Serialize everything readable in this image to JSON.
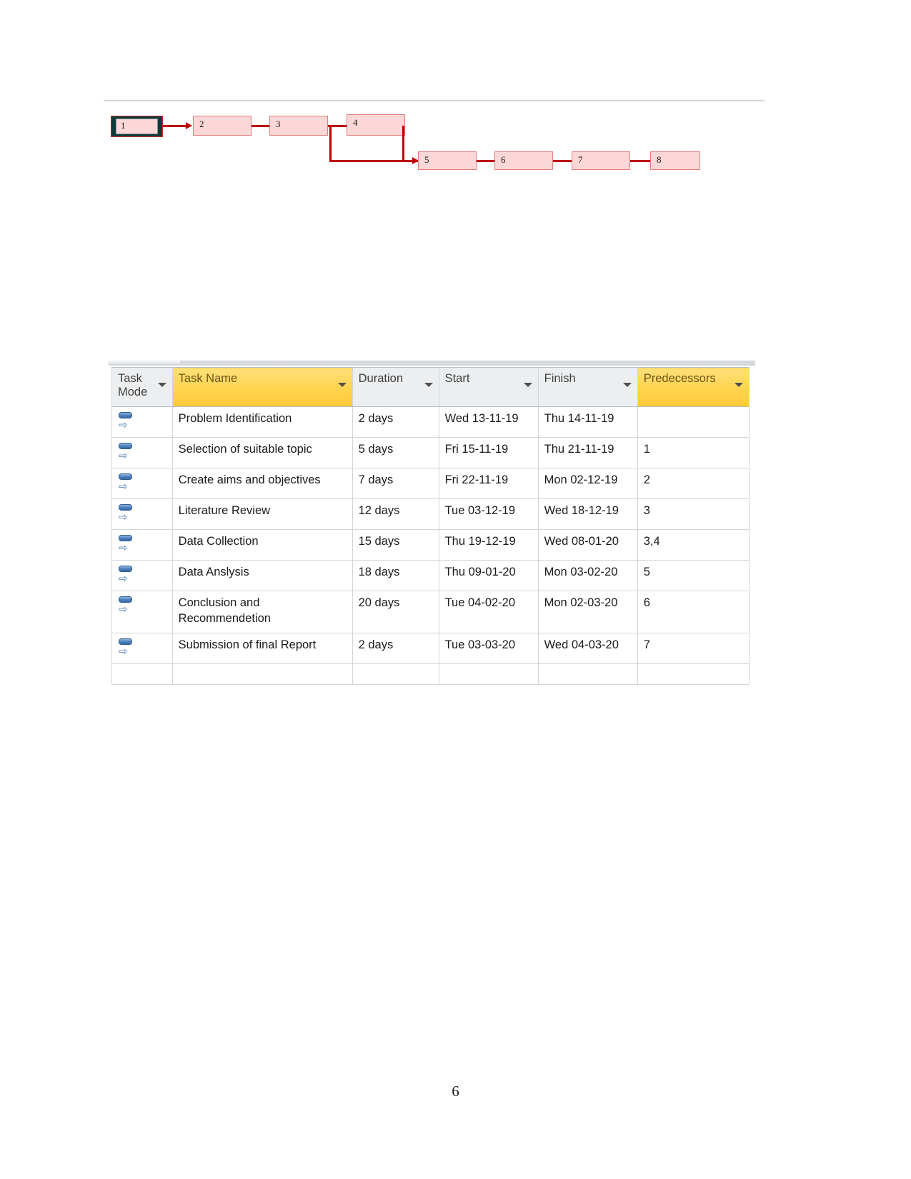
{
  "page": {
    "number": "6"
  },
  "network_diagram": {
    "name": "project-network-diagram",
    "node_fill_color": "#fbd7d7",
    "node_border_color": "#e87c7c",
    "connector_color": "#c00000",
    "selection_color": "#0d3b3b",
    "nodes": [
      {
        "id": "1",
        "label": "1",
        "selected": true
      },
      {
        "id": "2",
        "label": "2",
        "selected": false
      },
      {
        "id": "3",
        "label": "3",
        "selected": false
      },
      {
        "id": "4",
        "label": "4",
        "selected": false
      },
      {
        "id": "5",
        "label": "5",
        "selected": false
      },
      {
        "id": "6",
        "label": "6",
        "selected": false
      },
      {
        "id": "7",
        "label": "7",
        "selected": false
      },
      {
        "id": "8",
        "label": "8",
        "selected": false
      }
    ],
    "links": [
      {
        "from": "1",
        "to": "2"
      },
      {
        "from": "2",
        "to": "3"
      },
      {
        "from": "3",
        "to": "4"
      },
      {
        "from": "3",
        "to": "5"
      },
      {
        "from": "4",
        "to": "5"
      },
      {
        "from": "5",
        "to": "6"
      },
      {
        "from": "6",
        "to": "7"
      },
      {
        "from": "7",
        "to": "8"
      }
    ]
  },
  "gantt": {
    "name": "project-schedule-table",
    "header_highlight_color": "#ffd34d",
    "selected_cell_color": "#dce6f4",
    "columns": [
      {
        "key": "mode",
        "label": "Task Mode",
        "highlighted": false,
        "has_filter": true
      },
      {
        "key": "name",
        "label": "Task Name",
        "highlighted": true,
        "has_filter": true
      },
      {
        "key": "dur",
        "label": "Duration",
        "highlighted": false,
        "has_filter": true
      },
      {
        "key": "start",
        "label": "Start",
        "highlighted": false,
        "has_filter": true
      },
      {
        "key": "fin",
        "label": "Finish",
        "highlighted": false,
        "has_filter": true
      },
      {
        "key": "pred",
        "label": "Predecessors",
        "highlighted": true,
        "has_filter": true
      }
    ],
    "rows": [
      {
        "mode_icon": "auto-scheduled-icon",
        "name": "Problem Identification",
        "duration": "2 days",
        "start": "Wed 13-11-19",
        "finish": "Thu 14-11-19",
        "predecessors": "",
        "highlighted": false
      },
      {
        "mode_icon": "auto-scheduled-icon",
        "name": "Selection of suitable topic",
        "duration": "5 days",
        "start": "Fri 15-11-19",
        "finish": "Thu 21-11-19",
        "predecessors": "1",
        "highlighted": false
      },
      {
        "mode_icon": "auto-scheduled-icon",
        "name": "Create aims and objectives",
        "duration": "7 days",
        "start": "Fri 22-11-19",
        "finish": "Mon 02-12-19",
        "predecessors": "2",
        "highlighted": false
      },
      {
        "mode_icon": "auto-scheduled-icon",
        "name": "Literature Review",
        "duration": "12 days",
        "start": "Tue 03-12-19",
        "finish": "Wed 18-12-19",
        "predecessors": "3",
        "highlighted": false
      },
      {
        "mode_icon": "auto-scheduled-icon",
        "name": "Data Collection",
        "duration": "15 days",
        "start": "Thu 19-12-19",
        "finish": "Wed 08-01-20",
        "predecessors": "3,4",
        "highlighted": false
      },
      {
        "mode_icon": "auto-scheduled-icon",
        "name": "Data Anslysis",
        "duration": "18 days",
        "start": "Thu 09-01-20",
        "finish": "Mon 03-02-20",
        "predecessors": "5",
        "highlighted": false
      },
      {
        "mode_icon": "auto-scheduled-icon",
        "name": "Conclusion and Recommendetion",
        "duration": "20 days",
        "start": "Tue 04-02-20",
        "finish": "Mon 02-03-20",
        "predecessors": "6",
        "highlighted": false
      },
      {
        "mode_icon": "auto-scheduled-icon",
        "name": "Submission of final Report",
        "duration": "2 days",
        "start": "Tue 03-03-20",
        "finish": "Wed 04-03-20",
        "predecessors": "7",
        "highlighted": true
      }
    ]
  }
}
